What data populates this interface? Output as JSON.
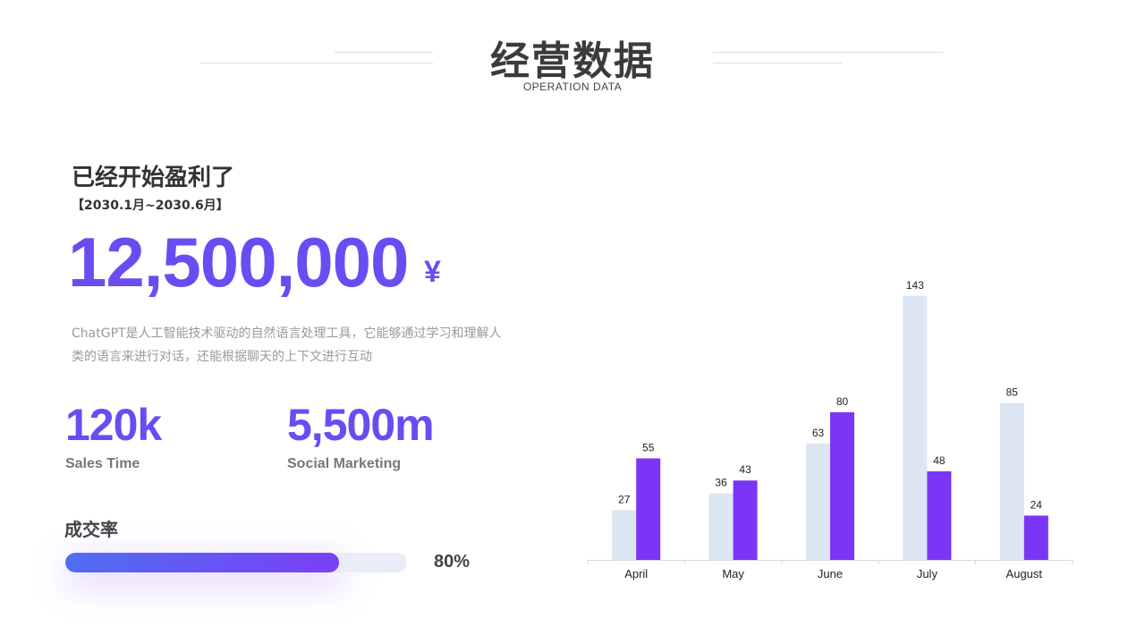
{
  "header": {
    "title": "经营数据",
    "subtitle": "OPERATION DATA"
  },
  "summary": {
    "headline": "已经开始盈利了",
    "period": "【2030.1月~2030.6月】",
    "amount": "12,500,000",
    "currency": "¥",
    "description": "ChatGPT是人工智能技术驱动的自然语言处理工具，它能够通过学习和理解人类的语言来进行对话，还能根据聊天的上下文进行互动"
  },
  "stats": [
    {
      "value": "120k",
      "label": "Sales Time"
    },
    {
      "value": "5,500m",
      "label": "Social Marketing"
    }
  ],
  "conversion": {
    "label": "成交率",
    "percent_text": "80%",
    "value": 0.8
  },
  "colors": {
    "accent": "#6a4cf2",
    "series_light": "#dce6f2",
    "series_dark": "#7b35f5"
  },
  "chart_data": {
    "type": "bar",
    "categories": [
      "April",
      "May",
      "June",
      "July",
      "August"
    ],
    "series": [
      {
        "values": [
          27,
          36,
          63,
          143,
          85
        ],
        "color": "#dce6f2"
      },
      {
        "values": [
          55,
          43,
          80,
          48,
          24
        ],
        "color": "#7b35f5"
      }
    ],
    "ylim": [
      0,
      155
    ],
    "grid": false,
    "legend": "none",
    "data_labels": true
  }
}
